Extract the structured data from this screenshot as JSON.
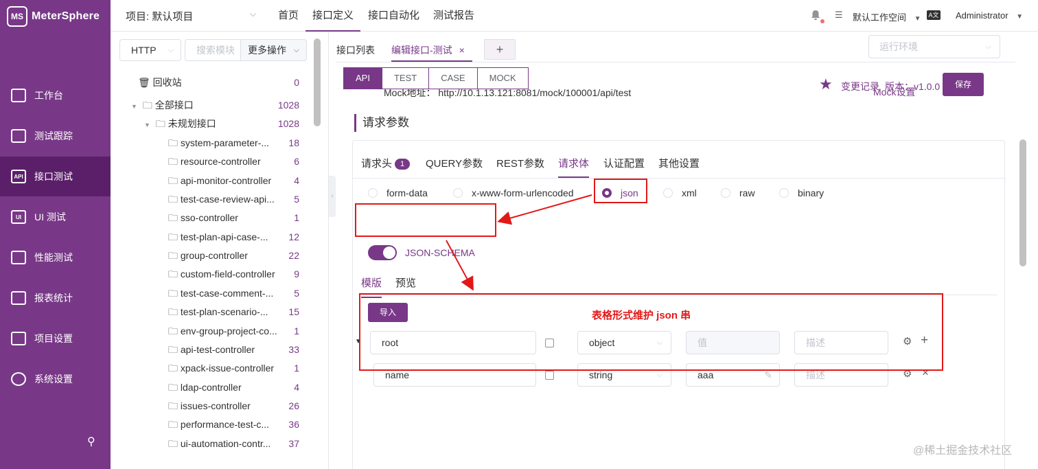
{
  "app": {
    "name": "MeterSphere",
    "logo_text": "MS"
  },
  "sidebar": {
    "items": [
      {
        "label": "工作台",
        "icon": "monitor-icon",
        "active": false
      },
      {
        "label": "测试跟踪",
        "icon": "clipboard-icon",
        "active": false
      },
      {
        "label": "接口测试",
        "icon": "api-icon",
        "icon_text": "API",
        "active": true
      },
      {
        "label": "UI 测试",
        "icon": "ui-icon",
        "icon_text": "UI",
        "active": false
      },
      {
        "label": "性能测试",
        "icon": "chart-icon",
        "active": false
      },
      {
        "label": "报表统计",
        "icon": "report-icon",
        "active": false
      },
      {
        "label": "项目设置",
        "icon": "folder-icon",
        "active": false
      },
      {
        "label": "系统设置",
        "icon": "gears-icon",
        "active": false
      }
    ],
    "pin_icon": "pin-icon"
  },
  "topbar": {
    "project": "项目: 默认项目",
    "nav": [
      "首页",
      "接口定义",
      "接口自动化",
      "测试报告"
    ],
    "active_nav": "接口定义",
    "workspace": "默认工作空间",
    "lang_icon": "translate-icon",
    "user": "Administrator"
  },
  "tree": {
    "protocol": "HTTP",
    "search_placeholder": "搜索模块",
    "more_ops": "更多操作",
    "recycle": {
      "label": "回收站",
      "count": "0"
    },
    "all": {
      "label": "全部接口",
      "count": "1028"
    },
    "unplanned": {
      "label": "未规划接口",
      "count": "1028"
    },
    "modules": [
      {
        "label": "system-parameter-...",
        "count": "18"
      },
      {
        "label": "resource-controller",
        "count": "6"
      },
      {
        "label": "api-monitor-controller",
        "count": "4"
      },
      {
        "label": "test-case-review-api...",
        "count": "5"
      },
      {
        "label": "sso-controller",
        "count": "1"
      },
      {
        "label": "test-plan-api-case-...",
        "count": "12"
      },
      {
        "label": "group-controller",
        "count": "22"
      },
      {
        "label": "custom-field-controller",
        "count": "9"
      },
      {
        "label": "test-case-comment-...",
        "count": "5"
      },
      {
        "label": "test-plan-scenario-...",
        "count": "15"
      },
      {
        "label": "env-group-project-co...",
        "count": "1"
      },
      {
        "label": "api-test-controller",
        "count": "33"
      },
      {
        "label": "xpack-issue-controller",
        "count": "1"
      },
      {
        "label": "ldap-controller",
        "count": "4"
      },
      {
        "label": "issues-controller",
        "count": "26"
      },
      {
        "label": "performance-test-c...",
        "count": "36"
      },
      {
        "label": "ui-automation-contr...",
        "count": "37"
      }
    ]
  },
  "editor": {
    "tabs": [
      "接口列表",
      "编辑接口-测试"
    ],
    "tab_close": "×",
    "tab_add": "+",
    "env_placeholder": "运行环境",
    "mode_tabs": [
      "API",
      "TEST",
      "CASE",
      "MOCK"
    ],
    "active_mode": "API",
    "mock_address": "Mock地址：  http://10.1.13.121:8081/mock/100001/api/test",
    "change_log": "变更记录",
    "version": "版本：v1.0.0",
    "mock_settings": "Mock设置",
    "save": "保存",
    "req_title": "请求参数",
    "req_tabs": [
      "请求头",
      "QUERY参数",
      "REST参数",
      "请求体",
      "认证配置",
      "其他设置"
    ],
    "header_count": "1",
    "active_req_tab": "请求体",
    "body_types": [
      "form-data",
      "x-www-form-urlencoded",
      "json",
      "xml",
      "raw",
      "binary"
    ],
    "body_selected": "json",
    "json_schema_label": "JSON-SCHEMA",
    "schema_tabs": [
      "模版",
      "预览"
    ],
    "import": "导入",
    "annotation": "表格形式维护 json 串",
    "rows": [
      {
        "name": "root",
        "type": "object",
        "value_placeholder": "值",
        "value": "",
        "desc_placeholder": "描述",
        "op_icon": "plus-icon",
        "op_text": "+"
      },
      {
        "name": "name",
        "type": "string",
        "value_placeholder": "值",
        "value": "aaa",
        "desc_placeholder": "描述",
        "op_icon": "close-icon",
        "op_text": "×"
      }
    ]
  },
  "watermark": "@稀土掘金技术社区",
  "colors": {
    "brand": "#783887",
    "annotation": "#e21818"
  }
}
